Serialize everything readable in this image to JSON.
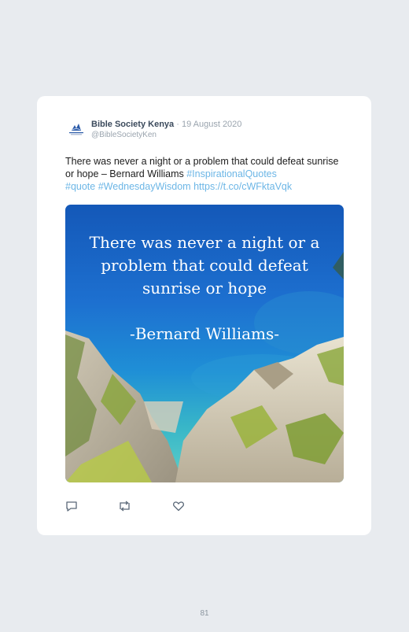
{
  "tweet": {
    "author_name": "Bible Society Kenya",
    "separator": "·",
    "date": "19 August 2020",
    "handle": "@BibleSocietyKen",
    "text_plain": "There was never a night or a problem that could defeat sunrise or hope – Bernard Williams ",
    "hashtag_1": "#InspirationalQuotes",
    "hashtag_2": "#quote",
    "hashtag_3": "#WednesdayWisdom",
    "url": "https://t.co/cWFktaVqk",
    "avatar_icon": "bible-society-logo-icon",
    "link_color": "#6cb6e6"
  },
  "media": {
    "quote_line_1": "There was never a night or a",
    "quote_line_2": "problem that could defeat",
    "quote_line_3": "sunrise or hope",
    "attribution": "-Bernard Williams-"
  },
  "actions": {
    "reply_icon": "reply-icon",
    "retweet_icon": "retweet-icon",
    "like_icon": "heart-icon"
  },
  "page": {
    "number": "81"
  }
}
